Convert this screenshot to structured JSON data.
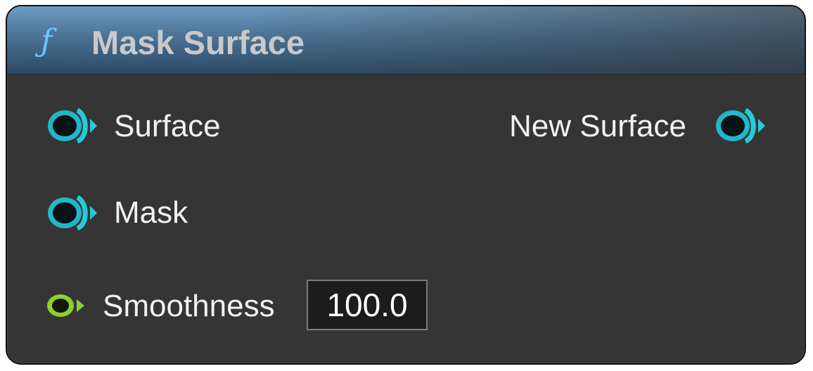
{
  "node": {
    "icon": "function-icon",
    "title": "Mask Surface",
    "header_color": "#4a7294",
    "function_icon_glyph": "ƒ"
  },
  "inputs": [
    {
      "label": "Surface",
      "pin_type": "object",
      "pin_color": "#2ec6d6"
    },
    {
      "label": "Mask",
      "pin_type": "object",
      "pin_color": "#2ec6d6"
    },
    {
      "label": "Smoothness",
      "pin_type": "float",
      "pin_color": "#8ed02e",
      "default_value": "100.0"
    }
  ],
  "outputs": [
    {
      "label": "New Surface",
      "pin_type": "object",
      "pin_color": "#2ec6d6"
    }
  ]
}
